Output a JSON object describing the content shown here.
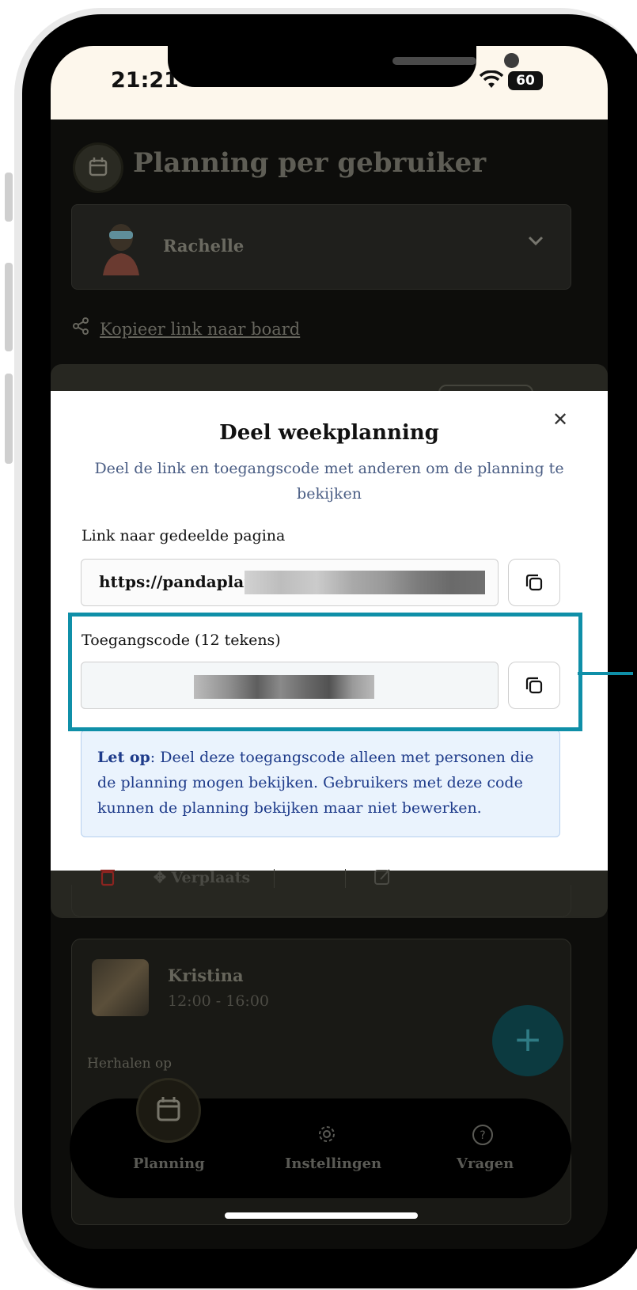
{
  "status_bar": {
    "time": "21:21",
    "battery": "60"
  },
  "app": {
    "title": "Planning per gebruiker",
    "selected_user": "Rachelle",
    "share_link_label": "Kopieer link naar board"
  },
  "modal": {
    "title": "Deel weekplanning",
    "subtitle": "Deel de link en toegangscode met anderen om de planning te bekijken",
    "link_label": "Link naar gedeelde pagina",
    "link_value": "https://pandaplan",
    "code_label": "Toegangscode (12 tekens)",
    "note_bold": "Let op",
    "note_text": ": Deel deze toegangscode alleen met personen die de planning mogen bekijken. Gebruikers met deze code kunnen de planning bekijken maar niet bewerken."
  },
  "background": {
    "move_label": "Verplaats",
    "card_name": "Kristina",
    "card_time": "12:00 - 16:00",
    "repeat_label": "Herhalen op"
  },
  "nav": {
    "items": [
      {
        "label": "Planning",
        "icon": "calendar-icon"
      },
      {
        "label": "Instellingen",
        "icon": "gear-icon"
      },
      {
        "label": "Vragen",
        "icon": "help-icon"
      }
    ]
  },
  "colors": {
    "highlight": "#0f8fa8",
    "note_text": "#1e3b8a",
    "note_bg": "#eaf3fd"
  }
}
